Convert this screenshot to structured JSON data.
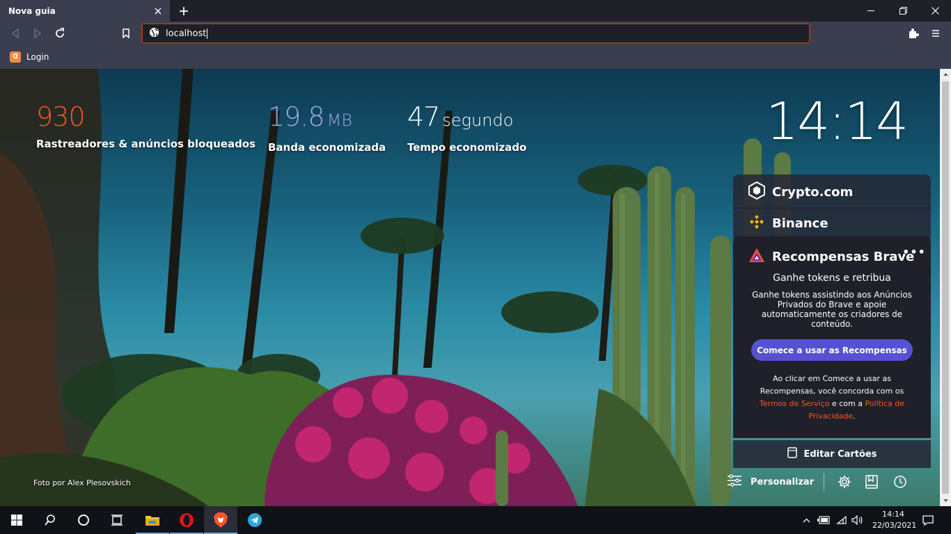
{
  "browser": {
    "tab": {
      "title": "Nova guia"
    },
    "address": {
      "value": "localhost"
    },
    "bookmarks": [
      {
        "label": "Login",
        "icon": "xampp-icon"
      }
    ]
  },
  "ntp": {
    "stats": [
      {
        "value": "930",
        "unit": "",
        "label": "Rastreadores & anúncios bloqueados",
        "color": "#fb542b"
      },
      {
        "value": "19.8",
        "unit": "MB",
        "label": "Banda economizada",
        "color": "#a0a5eb"
      },
      {
        "value": "47",
        "unit": "segundo",
        "label": "Tempo economizado",
        "color": "#ffffff"
      }
    ],
    "clock": "14:14",
    "cards": {
      "crypto": "Crypto.com",
      "binance": "Binance",
      "rewards": {
        "title": "Recompensas Brave",
        "subtitle": "Ganhe tokens e retribua",
        "description": "Ganhe tokens assistindo aos Anúncios Privados do Brave e apoie automaticamente os criadores de conteúdo.",
        "button": "Comece a usar as Recompensas",
        "terms_before": "Ao clicar em Comece a usar as Recompensas, você concorda com os ",
        "terms_link1": "Termos de Serviço",
        "terms_middle": " e com a ",
        "terms_link2": "Política de Privacidade",
        "terms_end": "."
      },
      "edit": "Editar Cartões"
    },
    "photo_credit": "Foto por Alex Plesovskich",
    "customize": "Personalizar",
    "accent": "#fb542b",
    "button_color": "#5651d1"
  },
  "taskbar": {
    "time": "14:14",
    "date": "22/03/2021",
    "apps": [
      "windows-start",
      "search",
      "cortana",
      "task-view",
      "file-explorer",
      "opera",
      "brave",
      "telegram"
    ]
  }
}
